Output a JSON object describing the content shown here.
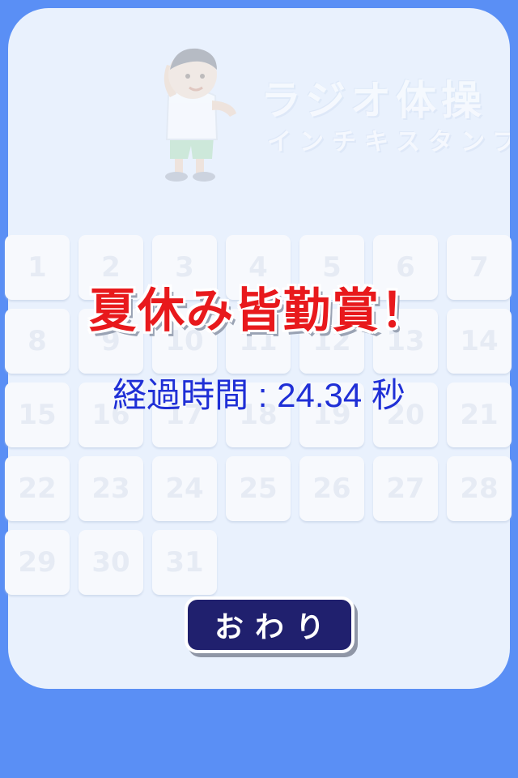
{
  "header": {
    "title": "ラジオ体操",
    "subtitle": "インチキスタンプ",
    "mascot_icon": "boy-stretching-icon"
  },
  "calendar": {
    "days": [
      "1",
      "2",
      "3",
      "4",
      "5",
      "6",
      "7",
      "8",
      "9",
      "10",
      "11",
      "12",
      "13",
      "14",
      "15",
      "16",
      "17",
      "18",
      "19",
      "20",
      "21",
      "22",
      "23",
      "24",
      "25",
      "26",
      "27",
      "28",
      "29",
      "30",
      "31"
    ]
  },
  "result": {
    "title": "夏休み皆勤賞！",
    "elapsed_label": "経過時間 : 24.34 秒"
  },
  "finish_button": {
    "label": "おわり"
  },
  "colors": {
    "background": "#5a8ff5",
    "panel": "#e9f1fd",
    "award_red": "#e8191c",
    "elapsed_blue": "#1f2fd6",
    "button_navy": "#20206e"
  }
}
